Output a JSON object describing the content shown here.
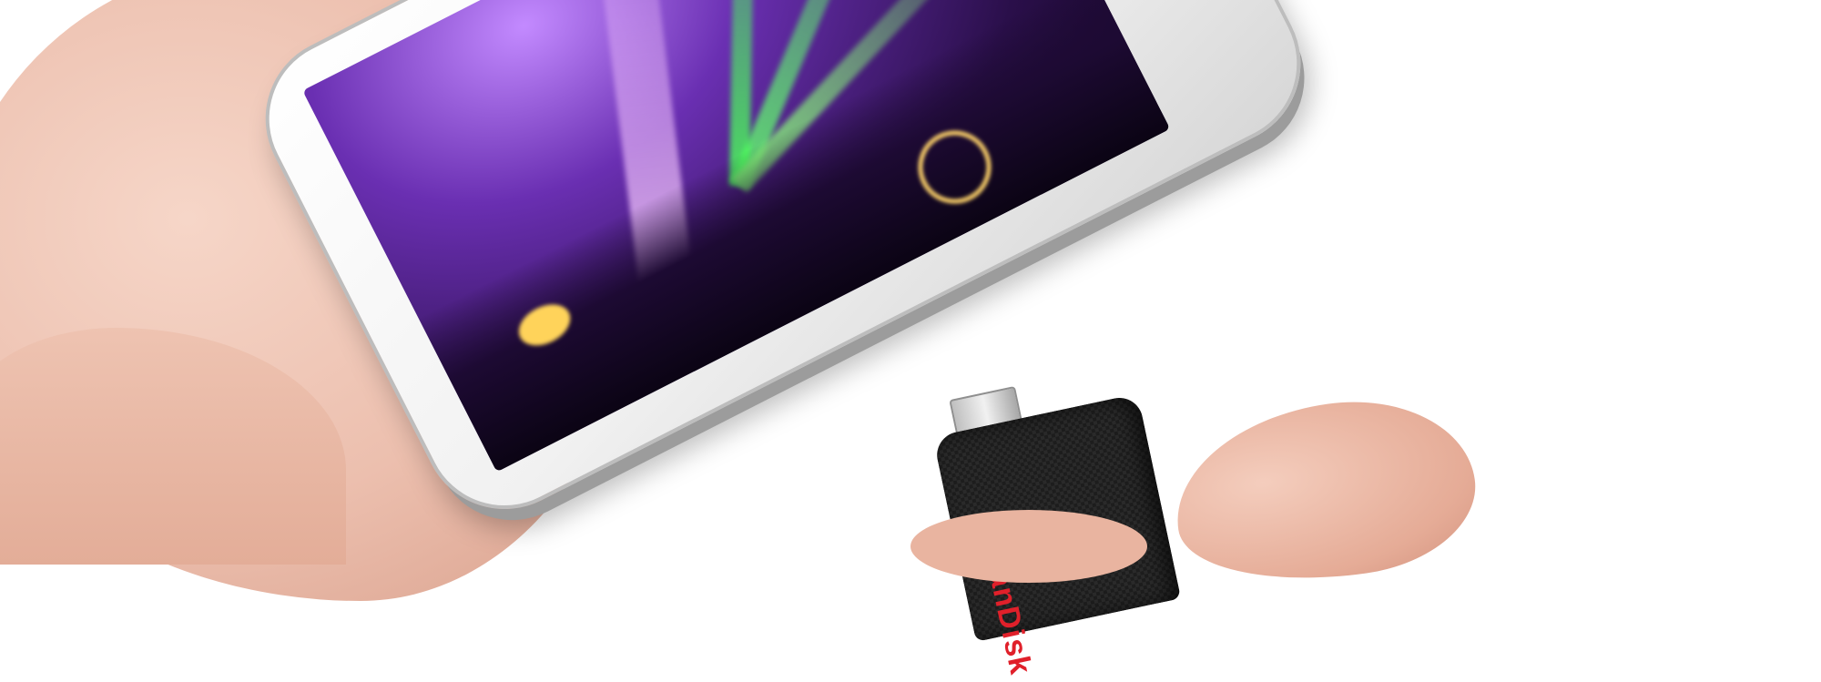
{
  "scene": {
    "subject": "smartphone-with-usb-flash-drive",
    "brand_logo_text": "SanDisk",
    "colors": {
      "background": "#ffffff",
      "phone_body": "#f1f1f1",
      "screen_purple": "#6a2fb2",
      "laser_green": "#62ff6e",
      "drive_body": "#1d1d1d",
      "logo_red": "#e0202a",
      "skin": "#ecbfae"
    }
  }
}
